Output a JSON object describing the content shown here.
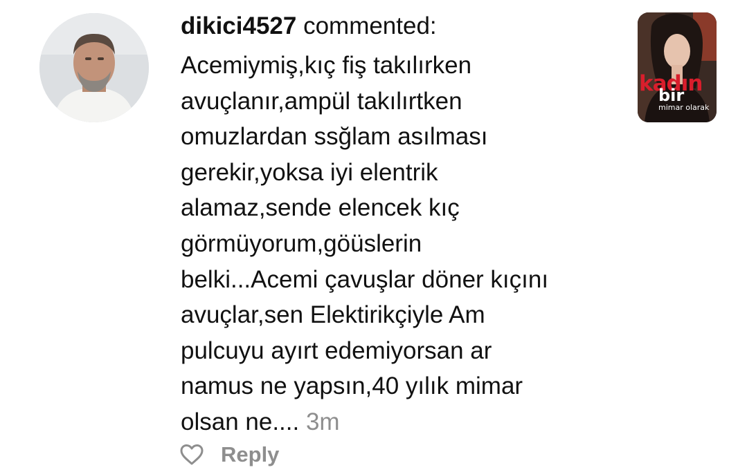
{
  "comment": {
    "username": "dikici4527",
    "action_text": " commented:",
    "body_lines": [
      "Acemiymiş,kıç fiş takılırken",
      "avuçlanır,ampül takılırtken",
      "omuzlardan ssğlam asılması",
      "gerekir,yoksa iyi elentrik",
      "alamaz,sende elencek kıç",
      "görmüyorum,göüslerin",
      "belki...Acemi çavuşlar döner kıçını",
      "avuçlar,sen Elektirikçiyle Am",
      "pulcuyu ayırt edemiyorsan ar",
      "namus ne yapsın,40 yılık mimar",
      "olsan ne...."
    ],
    "timestamp": "3m",
    "reply_label": "Reply",
    "like_icon": "heart-outline-icon"
  },
  "thumbnail": {
    "title": "kadın",
    "subtitle": "bir",
    "caption": "mimar olarak",
    "accent_color": "#d81e2c"
  },
  "colors": {
    "text": "#111111",
    "muted": "#8e8e8e",
    "background": "#ffffff"
  }
}
